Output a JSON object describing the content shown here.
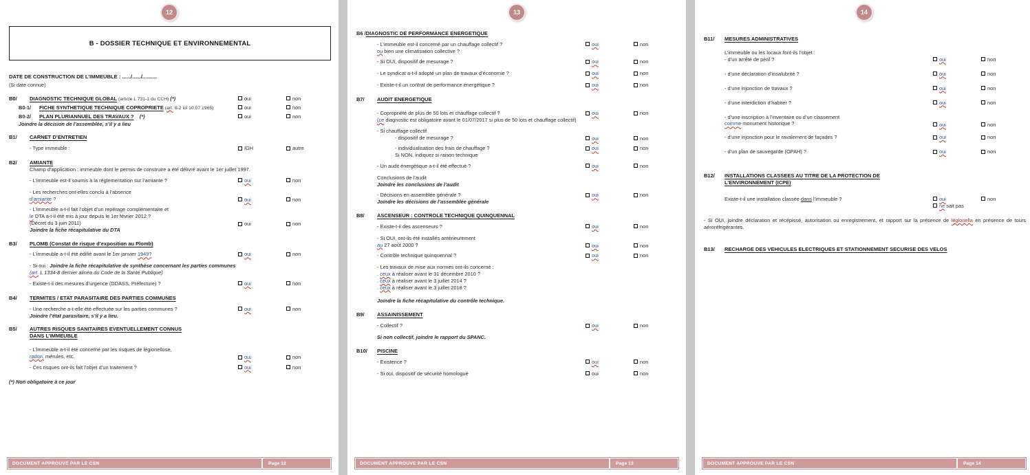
{
  "document": {
    "title": "B - DOSSIER TECHNIQUE ET ENVIRONNEMENTAL",
    "footer_left": "DOCUMENT APPROUVE PAR LE CSN",
    "colors": {
      "badge": "#c08a8a",
      "footer_bar": "#cf9a9a",
      "spellcheck_underline": "#c0392b",
      "hyperlink_blue": "#2b4f9e",
      "page_background": "#c8c8c8"
    },
    "options": {
      "oui": "oui",
      "non": "non",
      "igh": "IGH",
      "autre": "autre",
      "ne_sait_pas": "ne",
      "ne_sait_pas_rest": " sait pas"
    }
  },
  "page12": {
    "badge": "12",
    "footer_page": "Page 12",
    "date_label": "DATE DE CONSTRUCTION DE L’IMMEUBLE :   ....../....../..........",
    "date_sub": "(Si date connue)",
    "B0": {
      "num": "B0/",
      "title": "DIAGNOSTIC TECHNIQUE GLOBAL",
      "ref": " (article L 731-1 du CCH) ",
      "star": "(*)",
      "B0_1": {
        "num": "B0-1/",
        "title": "FICHE SYNTHETIQUE TECHNIQUE COPROPRIETE",
        "ref_spell": "art.",
        "ref_rest": " 8-2 loi 10.07.1965)"
      },
      "B0_2": {
        "num": "B0-2/",
        "title": "PLAN PLURIANNUEL DES TRAVAUX ?",
        "star": "(*)"
      },
      "note": "Joindre la décision de l’assemblée, s’il y a lieu"
    },
    "B1": {
      "num": "B1/",
      "title": "CARNET D’ENTRETIEN",
      "q1": "- Type immeuble :"
    },
    "B2": {
      "num": "B2/",
      "title": "AMIANTE",
      "scope": " Champ d’application : immeuble dont le permis de construire a été délivré avant le 1er juillet 1997.",
      "q1": "- L’immeuble est-il soumis à la réglementation sur l’amiante ?",
      "q2_l1": "- Les recherches ont-elles conclu à l’absence",
      "q2_l2_spell": "d’amiante",
      "q2_l2_rest": " ?",
      "q3_l1": "- L’immeuble a-t-il fait l’objet d’un repérage complémentaire et",
      "q3_l2_spell": "le",
      "q3_l2_rest": " DTA a-t-il été mis à jour depuis le 1er février 2012 ?",
      "q3_l3": "(Décret du 3 juin 2011)",
      "note": "Joindre la fiche récapitulative du DTA"
    },
    "B3": {
      "num": "B3/",
      "title": "PLOMB (Constat de risque d’exposition au Plomb)",
      "q1_pre": "- L’immeuble a-t-il été édifié avant le 1er janvier ",
      "q1_spell": "1949?",
      "note1_pre": "- Si oui : ",
      "note1": "Joindre la fiche récapitulative de synthèse concernant les parties communes",
      "note2_spell": "(art.",
      "note2": " L 1334-8 dernier alinéa du Code de la Santé Publique)",
      "q2": "- Existe-t-il des mesures d’urgence (DDASS, Préfecture) ?"
    },
    "B4": {
      "num": "B4/",
      "title": "TERMITES / ETAT PARASITAIRE DES PARTIES COMMUNES",
      "q1": "- Une recherche a-t-elle été effectuée sur les parties communes ?",
      "note": "Joindre l’état parasitaire, s’il y a lieu."
    },
    "B5": {
      "num": "B5/",
      "title_l1": "AUTRES RISQUES SANITAIRES EVENTUELLEMENT CONNUS",
      "title_l2": "DANS L’IMMEUBLE",
      "q1_l1": "- L’immeuble a-t-il été concerné par les risques de légionellose,",
      "q1_l2_spell": "radon,",
      "q1_l2_rest": " mérules, etc.",
      "q2": "- Ces risques ont-ils fait l’objet d’un traitement ?"
    },
    "footnote": "(*) Non obligatoire à ce jour"
  },
  "page13": {
    "badge": "13",
    "footer_page": "Page 13",
    "B6": {
      "num": "B6 /",
      "title": "DIAGNOSTIC DE PERFORMANCE ENERGETIQUE",
      "q1_l1": "- L’immeuble est-il concerné par un chauffage collectif ?",
      "q1_l2_spell": "ou",
      "q1_l2_rest": " bien une climatisation collective ?",
      "q2": "- Si OUI, dispositif de mesurage ?",
      "q3": "- Le syndicat a-t-il adopté un plan de travaux d’économie ?",
      "q4": "- Existe-t-il un contrat de performance énergétique ?"
    },
    "B7": {
      "num": "B7/",
      "title": "AUDIT ENERGETIQUE",
      "q1_l1": "- Copropriété de plus de 50 lots et chauffage collectif ?",
      "q1_l2_spell": "(ce",
      "q1_l2_rest": " diagnostic est obligatoire avant le 01/07/2017 si plus de 50 lots et chauffage collectif)",
      "q2_l1": "- Si chauffage collectif",
      "q2_l2": "- dispositif de mesurage ?",
      "q3_l1": "- individualisation des frais de chauffage ?",
      "q3_l2": "Si NON, indiquez si raison technique",
      "q4": "- Un audit énergétique a-t-il été effectué ?",
      "concl_l1": "Conclusions de l’audit",
      "concl_l2": "Joindre les conclusions de l’audit",
      "q5": "- Décisions en assemblée générale ?",
      "note": "Joindre les décisions de l’assemblée générale"
    },
    "B8": {
      "num": "B8/",
      "title": "ASCENSEUR : CONTROLE TECHNIQUE QUINQUENNAL",
      "q1": "- Existe-t-il des ascenseurs ?",
      "q2_l1": "- Si OUI, ont-ils été installés antérieurement",
      "q2_l2_spell": "au",
      "q2_l2_rest": " 27 août 2000 ?",
      "q3": "- Contrôle technique quinquennal ?",
      "q4_head": "- Les travaux de mise aux normes ont-ils concerné :",
      "bullets": [
        {
          "dot": ". ",
          "spell": "ceux",
          "rest": " à réaliser avant le 31 décembre 2010 ?"
        },
        {
          "dot": ". ",
          "spell": "ceux",
          "rest": " à réaliser avant le 3 juillet 2014 ?"
        },
        {
          "dot": ". ",
          "spell": "ceux",
          "rest": " à réaliser avant le 3 juillet 2018 ?"
        }
      ],
      "note": "Joindre la fiche récapitulative du contrôle technique."
    },
    "B9": {
      "num": "B9/",
      "title": "ASSAINISSEMENT",
      "q1": "- Collectif ?",
      "note": "Si non collectif, joindre le rapport du SPANC."
    },
    "B10": {
      "num": "B10/",
      "title": "PISCINE",
      "q1": "- Existence ?",
      "q2": "- Si oui, dispositif de sécurité homologué"
    }
  },
  "page14": {
    "badge": "14",
    "footer_page": "Page 14",
    "B11": {
      "num": "B11/",
      "title": "MESURES ADMINISTRATIVES",
      "intro": "L’immeuble ou les locaux font-ils l’objet :",
      "q1": "- d’un arrêté de péril ?",
      "q2": "- d’une déclaration d’insalubrité ?",
      "q3": "- d’une injonction de travaux ?",
      "q4": "- d’une interdiction d’habiter ?",
      "q5_l1": "- d’une inscription à l’inventaire ou d’un classement",
      "q5_l2_spell": "comme",
      "q5_l2_rest": " monument historique ?",
      "q6": "- d’une injonction pour le ravalement de façades ?",
      "q7": "- d’un plan de sauvegarde (OPAH) ?"
    },
    "B12": {
      "num": "B12/",
      "title_l1": "INSTALLATIONS CLASSEES AU TITRE DE LA PROTECTION DE",
      "title_l2": "L’ENVIRONNEMENT (ICPE)",
      "q1_pre": "Existe-t-il une installation classée ",
      "q1_u": "dans",
      "q1_post": " l’immeuble ?",
      "note_pre": "- Si OUI, joindre déclaration et récépissé, autorisation ou enregistrement, et rapport sur la présence de ",
      "note_spell": "légionella",
      "note_post": " en présence de tours aéroréfrigérantes."
    },
    "B13": {
      "num": "B13/",
      "title": "RECHARGE DES VEHICULES ELECTRIQUES ET STATIONNEMENT SECURISE DES VELOS"
    }
  }
}
